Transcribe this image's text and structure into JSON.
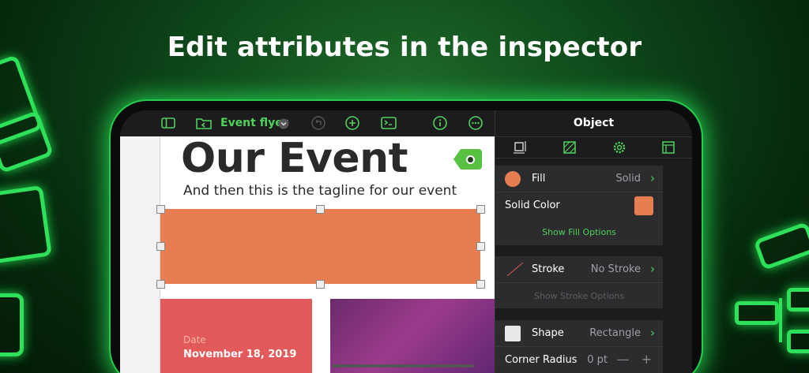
{
  "headline": "Edit attributes in the inspector",
  "toolbar": {
    "doc_title": "Event flyer",
    "icons": [
      "sidebar-icon",
      "back-folder-icon",
      "chevron-down-icon",
      "undo-icon",
      "add-icon",
      "terminal-icon",
      "info-icon",
      "more-icon"
    ]
  },
  "canvas": {
    "heading": "Our Event",
    "tagline": "And then this is the tagline for our event",
    "date_label": "Date",
    "date_value": "November 18, 2019",
    "shape_color": "#e87d52"
  },
  "inspector": {
    "title": "Object",
    "tabs": [
      "arrange-icon",
      "style-icon",
      "settings-icon",
      "layout-icon"
    ],
    "fill": {
      "label": "Fill",
      "value": "Solid"
    },
    "solid_color": {
      "label": "Solid Color",
      "color": "#e87d52"
    },
    "show_fill_options": "Show Fill Options",
    "stroke": {
      "label": "Stroke",
      "value": "No Stroke"
    },
    "show_stroke_options": "Show Stroke Options",
    "shape": {
      "label": "Shape",
      "value": "Rectangle"
    },
    "corner_radius": {
      "label": "Corner Radius",
      "value": "0 pt"
    }
  },
  "colors": {
    "accent": "#4fd15b",
    "glow": "#2ee05a"
  }
}
